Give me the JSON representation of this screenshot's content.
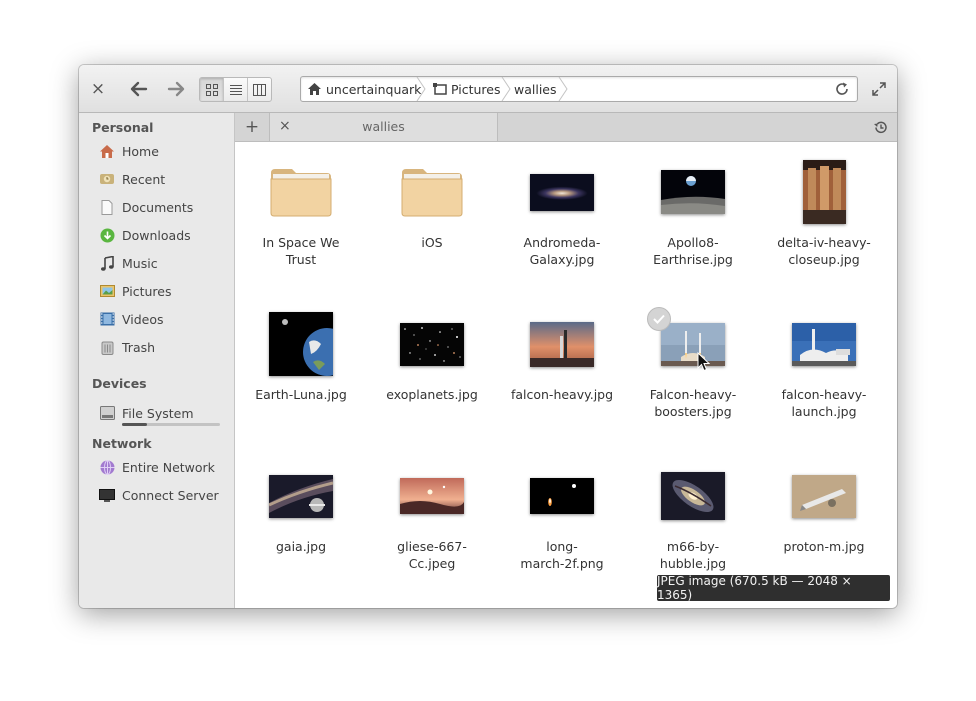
{
  "header": {
    "close_glyph": "×",
    "back_glyph": "back-arrow-icon",
    "forward_glyph": "forward-arrow-icon"
  },
  "path": {
    "crumbs": [
      "uncertainquark",
      "Pictures",
      "wallies"
    ]
  },
  "sidebar": {
    "sections": [
      {
        "title": "Personal",
        "items": [
          {
            "label": "Home",
            "icon": "home-icon"
          },
          {
            "label": "Recent",
            "icon": "recent-icon"
          },
          {
            "label": "Documents",
            "icon": "document-icon"
          },
          {
            "label": "Downloads",
            "icon": "download-icon"
          },
          {
            "label": "Music",
            "icon": "music-icon"
          },
          {
            "label": "Pictures",
            "icon": "pictures-icon"
          },
          {
            "label": "Videos",
            "icon": "videos-icon"
          },
          {
            "label": "Trash",
            "icon": "trash-icon"
          }
        ]
      },
      {
        "title": "Devices",
        "items": [
          {
            "label": "File System",
            "icon": "drive-icon",
            "usage_fraction": 0.25
          }
        ]
      },
      {
        "title": "Network",
        "items": [
          {
            "label": "Entire Network",
            "icon": "network-icon"
          },
          {
            "label": "Connect Server",
            "icon": "server-icon"
          }
        ]
      }
    ]
  },
  "tabs": {
    "add_glyph": "+",
    "tab_close_glyph": "×",
    "active_tab": "wallies"
  },
  "files": [
    {
      "name": "In Space We Trust",
      "label_lines": [
        "In Space We",
        "Trust"
      ],
      "kind": "folder"
    },
    {
      "name": "iOS",
      "label_lines": [
        "iOS"
      ],
      "kind": "folder"
    },
    {
      "name": "Andromeda-Galaxy.jpg",
      "label_lines": [
        "Andromeda-",
        "Galaxy.jpg"
      ],
      "kind": "galaxy"
    },
    {
      "name": "Apollo8-Earthrise.jpg",
      "label_lines": [
        "Apollo8-",
        "Earthrise.jpg"
      ],
      "kind": "earthrise"
    },
    {
      "name": "delta-iv-heavy-closeup.jpg",
      "label_lines": [
        "delta-iv-heavy-",
        "closeup.jpg"
      ],
      "kind": "delta"
    },
    {
      "name": "Earth-Luna.jpg",
      "label_lines": [
        "Earth-Luna.jpg"
      ],
      "kind": "earthluna"
    },
    {
      "name": "exoplanets.jpg",
      "label_lines": [
        "exoplanets.jpg"
      ],
      "kind": "stars"
    },
    {
      "name": "falcon-heavy.jpg",
      "label_lines": [
        "falcon-heavy.jpg"
      ],
      "kind": "falcon"
    },
    {
      "name": "Falcon-heavy-boosters.jpg",
      "label_lines": [
        "Falcon-heavy-",
        "boosters.jpg"
      ],
      "kind": "boosters",
      "hovered": true
    },
    {
      "name": "falcon-heavy-launch.jpg",
      "label_lines": [
        "falcon-heavy-",
        "launch.jpg"
      ],
      "kind": "launch"
    },
    {
      "name": "gaia.jpg",
      "label_lines": [
        "gaia.jpg"
      ],
      "kind": "gaia"
    },
    {
      "name": "gliese-667-Cc.jpeg",
      "label_lines": [
        "gliese-667-",
        "Cc.jpeg"
      ],
      "kind": "gliese"
    },
    {
      "name": "long-march-2f.png",
      "label_lines": [
        "long-",
        "march-2f.png"
      ],
      "kind": "longmarch"
    },
    {
      "name": "m66-by-hubble.jpg",
      "label_lines": [
        "m66-by-",
        "hubble.jpg"
      ],
      "kind": "m66"
    },
    {
      "name": "proton-m.jpg",
      "label_lines": [
        "proton-m.jpg"
      ],
      "kind": "proton"
    }
  ],
  "tooltip": {
    "text": "JPEG image (670.5 kB — 2048 × 1365)"
  }
}
